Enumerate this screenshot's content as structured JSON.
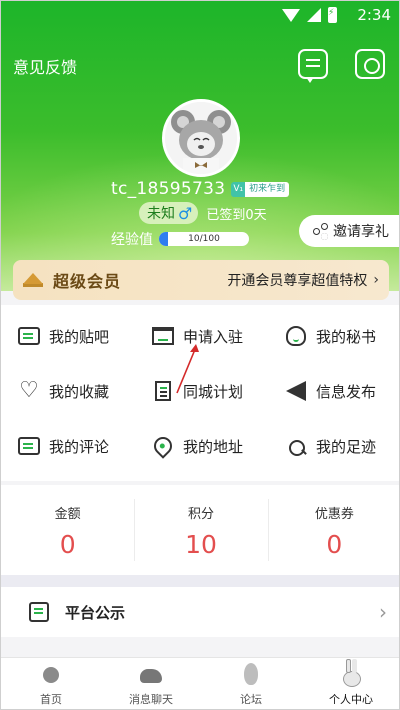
{
  "status_bar": {
    "time": "2:34",
    "icons": [
      "wifi-icon",
      "signal-icon",
      "battery-icon"
    ]
  },
  "header": {
    "feedback_label": "意见反馈",
    "message_icon": "message-icon",
    "settings_icon": "settings-gear-icon"
  },
  "profile": {
    "avatar_icon": "koala-avatar",
    "username": "tc_18595733",
    "level_badge_v": "V₁",
    "level_badge_text": "初来乍到",
    "gender_text": "未知",
    "gender_symbol": "♂",
    "signin_text": "已签到0天",
    "exp_label": "经验值",
    "exp_text": "10/100",
    "exp_fraction": 0.1
  },
  "invite": {
    "label": "邀请享礼",
    "icon": "share-icon"
  },
  "vip_banner": {
    "title": "超级会员",
    "description": "开通会员尊享超值特权",
    "chevron": "›"
  },
  "menu": {
    "items": [
      {
        "label": "我的贴吧",
        "icon": "post-bar-icon"
      },
      {
        "label": "申请入驻",
        "icon": "store-icon"
      },
      {
        "label": "我的秘书",
        "icon": "headset-icon"
      },
      {
        "label": "我的收藏",
        "icon": "heart-icon"
      },
      {
        "label": "同城计划",
        "icon": "document-icon"
      },
      {
        "label": "信息发布",
        "icon": "send-icon"
      },
      {
        "label": "我的评论",
        "icon": "comment-icon"
      },
      {
        "label": "我的地址",
        "icon": "location-pin-icon"
      },
      {
        "label": "我的足迹",
        "icon": "footprint-icon"
      }
    ]
  },
  "stats": [
    {
      "label": "金额",
      "value": "0"
    },
    {
      "label": "积分",
      "value": "10"
    },
    {
      "label": "优惠券",
      "value": "0"
    }
  ],
  "notice": {
    "label": "平台公示",
    "chevron": "›"
  },
  "tabbar": {
    "tabs": [
      {
        "label": "首页",
        "icon": "home-lotus-icon",
        "active": false
      },
      {
        "label": "消息聊天",
        "icon": "chat-rocks-icon",
        "active": false
      },
      {
        "label": "论坛",
        "icon": "forum-egg-icon",
        "active": false
      },
      {
        "label": "个人中心",
        "icon": "profile-rabbit-icon",
        "active": true
      }
    ]
  },
  "colors": {
    "header_green": "#1db52a",
    "stat_value_red": "#e34e4e",
    "accent_green": "#2bb34b",
    "exp_bar_blue": "#2e7df0",
    "vip_banner_bg": "#f5e2c0"
  }
}
